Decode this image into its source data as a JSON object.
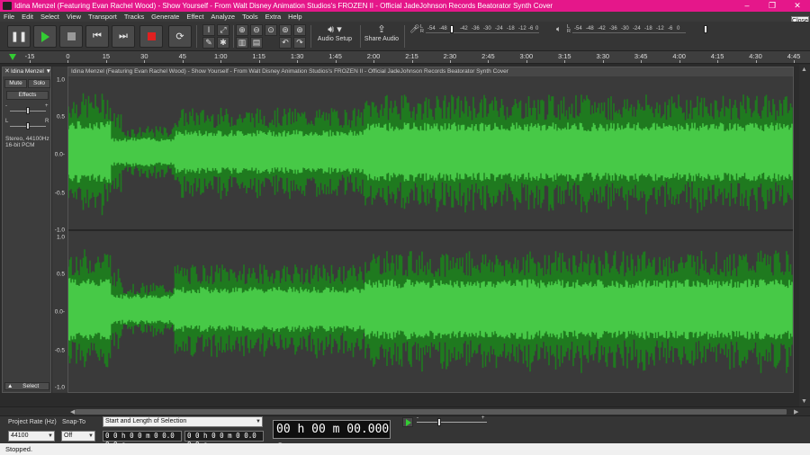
{
  "window": {
    "title": "Idina Menzel (Featuring Evan Rachel Wood) - Show Yourself - From Walt Disney Animation Studios's FROZEN II - Official JadeJohnson Records Beatorator Synth Cover",
    "minimize": "–",
    "maximize": "❐",
    "close": "✕",
    "close_tooltip": "Close"
  },
  "menu": [
    "File",
    "Edit",
    "Select",
    "View",
    "Transport",
    "Tracks",
    "Generate",
    "Effect",
    "Analyze",
    "Tools",
    "Extra",
    "Help"
  ],
  "toolbar": {
    "audio_setup": "Audio Setup",
    "share_audio": "Share Audio",
    "record_meter": {
      "l": "L",
      "r": "R",
      "ticks": [
        "-54",
        "-48",
        "-42",
        "-36",
        "-30",
        "-24",
        "-18",
        "-12",
        "-6",
        "0"
      ]
    },
    "playback_meter": {
      "l": "L",
      "r": "R",
      "ticks": [
        "-54",
        "-48",
        "-42",
        "-36",
        "-30",
        "-24",
        "-18",
        "-12",
        "-6",
        "0"
      ]
    }
  },
  "timeline": {
    "ticks": [
      "-15",
      "0",
      "15",
      "30",
      "45",
      "1:00",
      "1:15",
      "1:30",
      "1:45",
      "2:00",
      "2:15",
      "2:30",
      "2:45",
      "3:00",
      "3:15",
      "3:30",
      "3:45",
      "4:00",
      "4:15",
      "4:30",
      "4:45"
    ]
  },
  "track": {
    "name": "Idina Menzel",
    "close": "✕",
    "dropdown": "▼",
    "mute": "Mute",
    "solo": "Solo",
    "effects": "Effects",
    "gain_minus": "-",
    "gain_plus": "+",
    "pan_l": "L",
    "pan_r": "R",
    "info_line1": "Stereo, 44100Hz",
    "info_line2": "16-bit PCM",
    "select": "Select",
    "collapse": "▲",
    "clip_title": "Idina Menzel (Featuring Evan Rachel Wood) - Show Yourself - From Walt Disney Animation Studios's FROZEN II - Official JadeJohnson Records Beatorator Synth Cover",
    "vruler_top": [
      "1.0",
      "0.5",
      "0.0-",
      "-0.5",
      "-1.0"
    ],
    "vruler_bottom": [
      "1.0",
      "0.5",
      "0.0-",
      "-0.5",
      "-1.0"
    ],
    "wave_color_outer": "#1f7a1f",
    "wave_color_inner": "#47c947"
  },
  "selection_bar": {
    "project_rate_label": "Project Rate (Hz)",
    "project_rate_value": "44100",
    "snap_to_label": "Snap-To",
    "snap_to_value": "Off",
    "selection_mode": "Start and Length of Selection",
    "start_time": "0 0 h 0 0 m 0 0.0 0 0 s",
    "length_time": "0 0 h 0 0 m 0 0.0 0 0 s",
    "big_time": "00 h 00 m 00.000 s",
    "speed_minus": "-",
    "speed_plus": "+"
  },
  "status": "Stopped."
}
